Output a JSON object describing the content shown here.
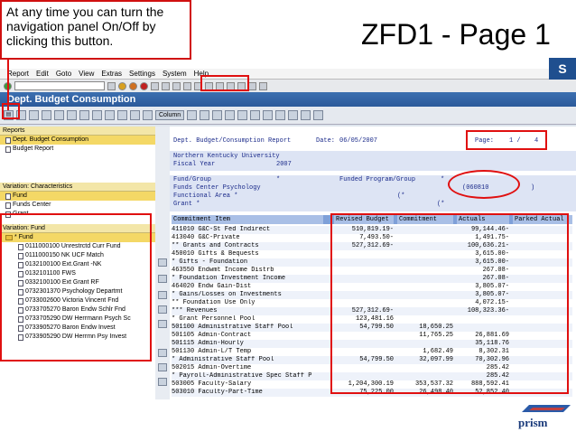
{
  "slide": {
    "title": "ZFD1 - Page 1",
    "callout": "At any time you can turn the navigation panel On/Off by clicking this button."
  },
  "sap": {
    "logo": "S",
    "menu": [
      "Report",
      "Edit",
      "Goto",
      "View",
      "Extras",
      "Settings",
      "System",
      "Help"
    ],
    "window_title": "Dept. Budget Consumption",
    "column_button": "Column",
    "nav": {
      "reports_head": "Reports",
      "reports": [
        "Dept. Budget Consumption",
        "Budget Report"
      ],
      "variation_chars_head": "Variation: Characteristics",
      "chars": [
        "Fund",
        "Funds Center",
        "Grant"
      ],
      "variation_fund_head": "Variation: Fund",
      "fund_root": "* Fund",
      "funds": [
        "0111000100 Unrestrctd Curr Fund",
        "0111000150 NK UCF Match",
        "0132100100 Ext.Grant -NK",
        "0132101100 FWS",
        "0332100100 Ext Grant RF",
        "0732301370 Psychology Departmt",
        "0733002600 Victoria Vincent Fnd",
        "0733705270 Baron Endw Schlr Fnd",
        "0733705290 DW Herrmann Psych Sc",
        "0733905270 Baron Endw Invest",
        "0733905290 DW Herrmn Psy Invest"
      ]
    },
    "report": {
      "header_left": "Dept. Budget/Consumption Report",
      "date_label": "Date:",
      "date": "06/05/2007",
      "page_label": "Page:",
      "page": "1 /",
      "page_total": "4",
      "university": "Northern Kentucky University",
      "fiscal_year_label": "Fiscal Year",
      "fiscal_year": "2007",
      "fund_group_label": "Fund/Group",
      "fund_group_value": "*",
      "funds_center_label": "Funds Center Psychology",
      "funded_program_label": "Funded Program/Group",
      "funded_program_value": "*",
      "funded_program_code": "(060810",
      "funded_program_close": ")",
      "functional_area_label": "Functional Area *",
      "functional_area_value": "(*",
      "grant_label": "Grant *",
      "grant_value": "(*",
      "columns": [
        "Commitment Item",
        "Revised Budget",
        "Commitment",
        "Actuals",
        "Parked Actual"
      ],
      "rows": [
        {
          "item": "411010  G&C-St Fed Indirect",
          "budget": "510,819.19-",
          "commit": "",
          "actual": "99,144.46-"
        },
        {
          "item": "413040  G&C-Private",
          "budget": "7,493.50-",
          "commit": "",
          "actual": "1,491.75-"
        },
        {
          "item": "**  Grants and Contracts",
          "budget": "527,312.69-",
          "commit": "",
          "actual": "100,636.21-"
        },
        {
          "item": "    450010  Gifts & Bequests",
          "budget": "",
          "commit": "",
          "actual": "3,615.00-"
        },
        {
          "item": "*   Gifts - Foundation",
          "budget": "",
          "commit": "",
          "actual": "3,615.00-"
        },
        {
          "item": "    463550  Endwmt Income Distrb",
          "budget": "",
          "commit": "",
          "actual": "267.08-"
        },
        {
          "item": "*   Foundation Investment Income",
          "budget": "",
          "commit": "",
          "actual": "267.08-"
        },
        {
          "item": "    464020  Endw Gain-Dist",
          "budget": "",
          "commit": "",
          "actual": "3,805.07-"
        },
        {
          "item": "*   Gains/Losses on Investments",
          "budget": "",
          "commit": "",
          "actual": "3,805.07-"
        },
        {
          "item": "**  Foundation Use Only",
          "budget": "",
          "commit": "",
          "actual": "4,072.15-"
        },
        {
          "item": "*** Revenues",
          "budget": "527,312.69-",
          "commit": "",
          "actual": "108,323.36-"
        },
        {
          "item": "*   Grant Personnel Pool",
          "budget": "123,481.16",
          "commit": "",
          "actual": ""
        },
        {
          "item": "    501100  Administrative Staff Pool",
          "budget": "54,799.50",
          "commit": "18,650.25",
          "actual": ""
        },
        {
          "item": "    501105  Admin-Contract",
          "budget": "",
          "commit": "11,765.25",
          "actual": "26,881.69"
        },
        {
          "item": "    501115  Admin-Hourly",
          "budget": "",
          "commit": "",
          "actual": "35,118.76"
        },
        {
          "item": "    501130  Admin-L/T Temp",
          "budget": "",
          "commit": "1,682.49",
          "actual": "8,302.31"
        },
        {
          "item": "*   Administrative Staff Pool",
          "budget": "54,799.50",
          "commit": "32,097.99",
          "actual": "70,302.96"
        },
        {
          "item": "    502015  Admin-Overtime",
          "budget": "",
          "commit": "",
          "actual": "285.42"
        },
        {
          "item": "*   Payroll-Administrative Spec Staff P",
          "budget": "",
          "commit": "",
          "actual": "285.42"
        },
        {
          "item": "    503005  Faculty-Salary",
          "budget": "1,204,300.19",
          "commit": "353,537.32",
          "actual": "888,592.41"
        },
        {
          "item": "    503010  Faculty-Part-Time",
          "budget": "75,225.00",
          "commit": "26,498.40",
          "actual": "52,852.40"
        }
      ]
    }
  },
  "brand": {
    "name": "prism"
  },
  "colors": {
    "highlight": "#e01010",
    "title_bar": "#2b5a9a",
    "panel_head": "#f3e6a8"
  }
}
